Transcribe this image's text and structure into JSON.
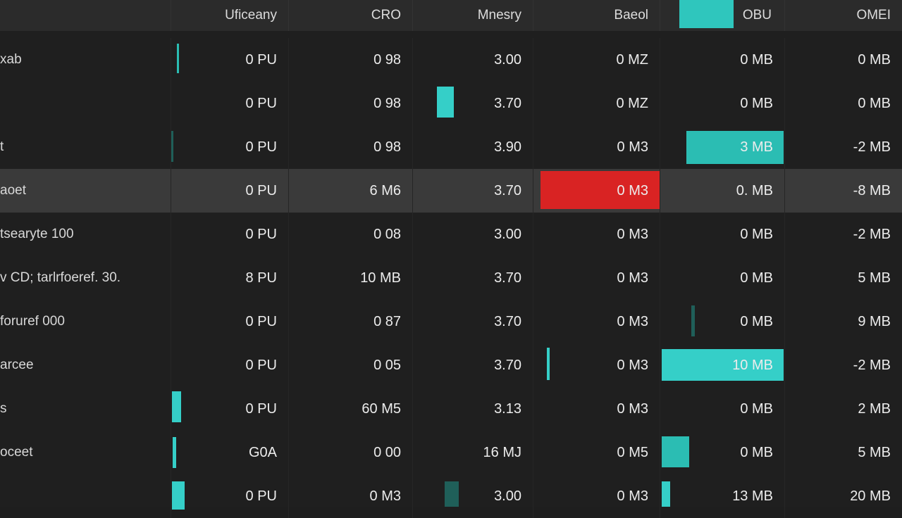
{
  "header": {
    "cols": [
      "Uficeany",
      "CRO",
      "Mnesry",
      "Baeol",
      "OBU",
      "OMEI"
    ]
  },
  "rows": [
    {
      "name": "xab",
      "c1": "0 PU",
      "c2": "0 98",
      "c3": "3.00",
      "c4": "0 MZ",
      "c5": "0 MB",
      "c6": "0 MB"
    },
    {
      "name": "",
      "c1": "0 PU",
      "c2": "0 98",
      "c3": "3.70",
      "c4": "0 MZ",
      "c5": "0 MB",
      "c6": "0 MB"
    },
    {
      "name": "t",
      "c1": "0 PU",
      "c2": "0 98",
      "c3": "3.90",
      "c4": "0 M3",
      "c5": "3 MB",
      "c6": "-2 MB"
    },
    {
      "name": "aoet",
      "c1": "0 PU",
      "c2": "6 M6",
      "c3": "3.70",
      "c4": "0 M3",
      "c5": "0. MB",
      "c6": "-8 MB"
    },
    {
      "name": "tsearyte 100",
      "c1": "0 PU",
      "c2": "0 08",
      "c3": "3.00",
      "c4": "0 M3",
      "c5": "0 MB",
      "c6": "-2 MB"
    },
    {
      "name": "v CD; tarlrfoeref. 30.",
      "c1": "8 PU",
      "c2": "10 MB",
      "c3": "3.70",
      "c4": "0 M3",
      "c5": "0 MB",
      "c6": "5 MB"
    },
    {
      "name": "foruref 000",
      "c1": "0 PU",
      "c2": "0 87",
      "c3": "3.70",
      "c4": "0 M3",
      "c5": "0 MB",
      "c6": "9 MB"
    },
    {
      "name": "arcee",
      "c1": "0 PU",
      "c2": "0 05",
      "c3": "3.70",
      "c4": "0 M3",
      "c5": "10 MB",
      "c6": "-2 MB"
    },
    {
      "name": "s",
      "c1": "0 PU",
      "c2": "60 M5",
      "c3": "3.13",
      "c4": "0 M3",
      "c5": "0 MB",
      "c6": "2 MB"
    },
    {
      "name": "oceet",
      "c1": "G0A",
      "c2": "0 00",
      "c3": "16 MJ",
      "c4": "0 M5",
      "c5": "0 MB",
      "c6": "5 MB"
    },
    {
      "name": "",
      "c1": "0 PU",
      "c2": "0 M3",
      "c3": "3.00",
      "c4": "0 M3",
      "c5": "13 MB",
      "c6": "20 MB"
    }
  ],
  "colors": {
    "accent": "#35cfc8",
    "alert": "#d92323",
    "background": "#1f1f1f"
  }
}
